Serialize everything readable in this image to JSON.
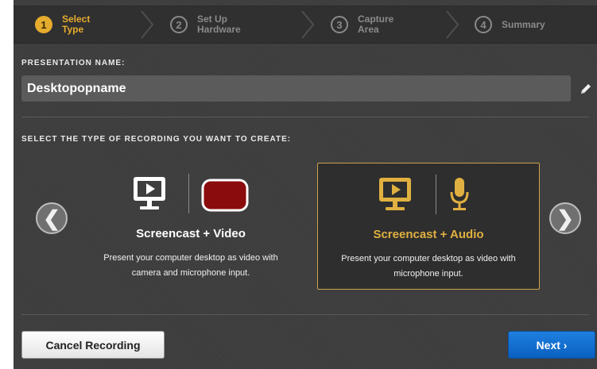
{
  "steps": [
    {
      "number": "1",
      "label": "Select Type",
      "active": true
    },
    {
      "number": "2",
      "label": "Set Up Hardware",
      "active": false
    },
    {
      "number": "3",
      "label": "Capture Area",
      "active": false
    },
    {
      "number": "4",
      "label": "Summary",
      "active": false
    }
  ],
  "presentation": {
    "label": "PRESENTATION NAME:",
    "value": "Desktopopname",
    "edit_icon": "pencil-icon"
  },
  "recording_type": {
    "label": "SELECT THE TYPE OF RECORDING YOU WANT TO CREATE:",
    "prev_arrow": "❮",
    "next_arrow": "❯",
    "options": [
      {
        "title": "Screencast + Video",
        "description_line1": "Present your computer desktop as video with",
        "description_line2": "camera and microphone input.",
        "icons": [
          "monitor-icon",
          "camera-icon"
        ],
        "selected": false
      },
      {
        "title": "Screencast + Audio",
        "description_line1": "Present your computer desktop as video with",
        "description_line2": "microphone input.",
        "icons": [
          "monitor-icon",
          "microphone-icon"
        ],
        "selected": true
      }
    ]
  },
  "footer": {
    "cancel_label": "Cancel Recording",
    "next_label": "Next ›"
  },
  "colors": {
    "accent": "#e6ac2e",
    "primary_button": "#1a74d6",
    "camera_red": "#8b0c0c"
  }
}
